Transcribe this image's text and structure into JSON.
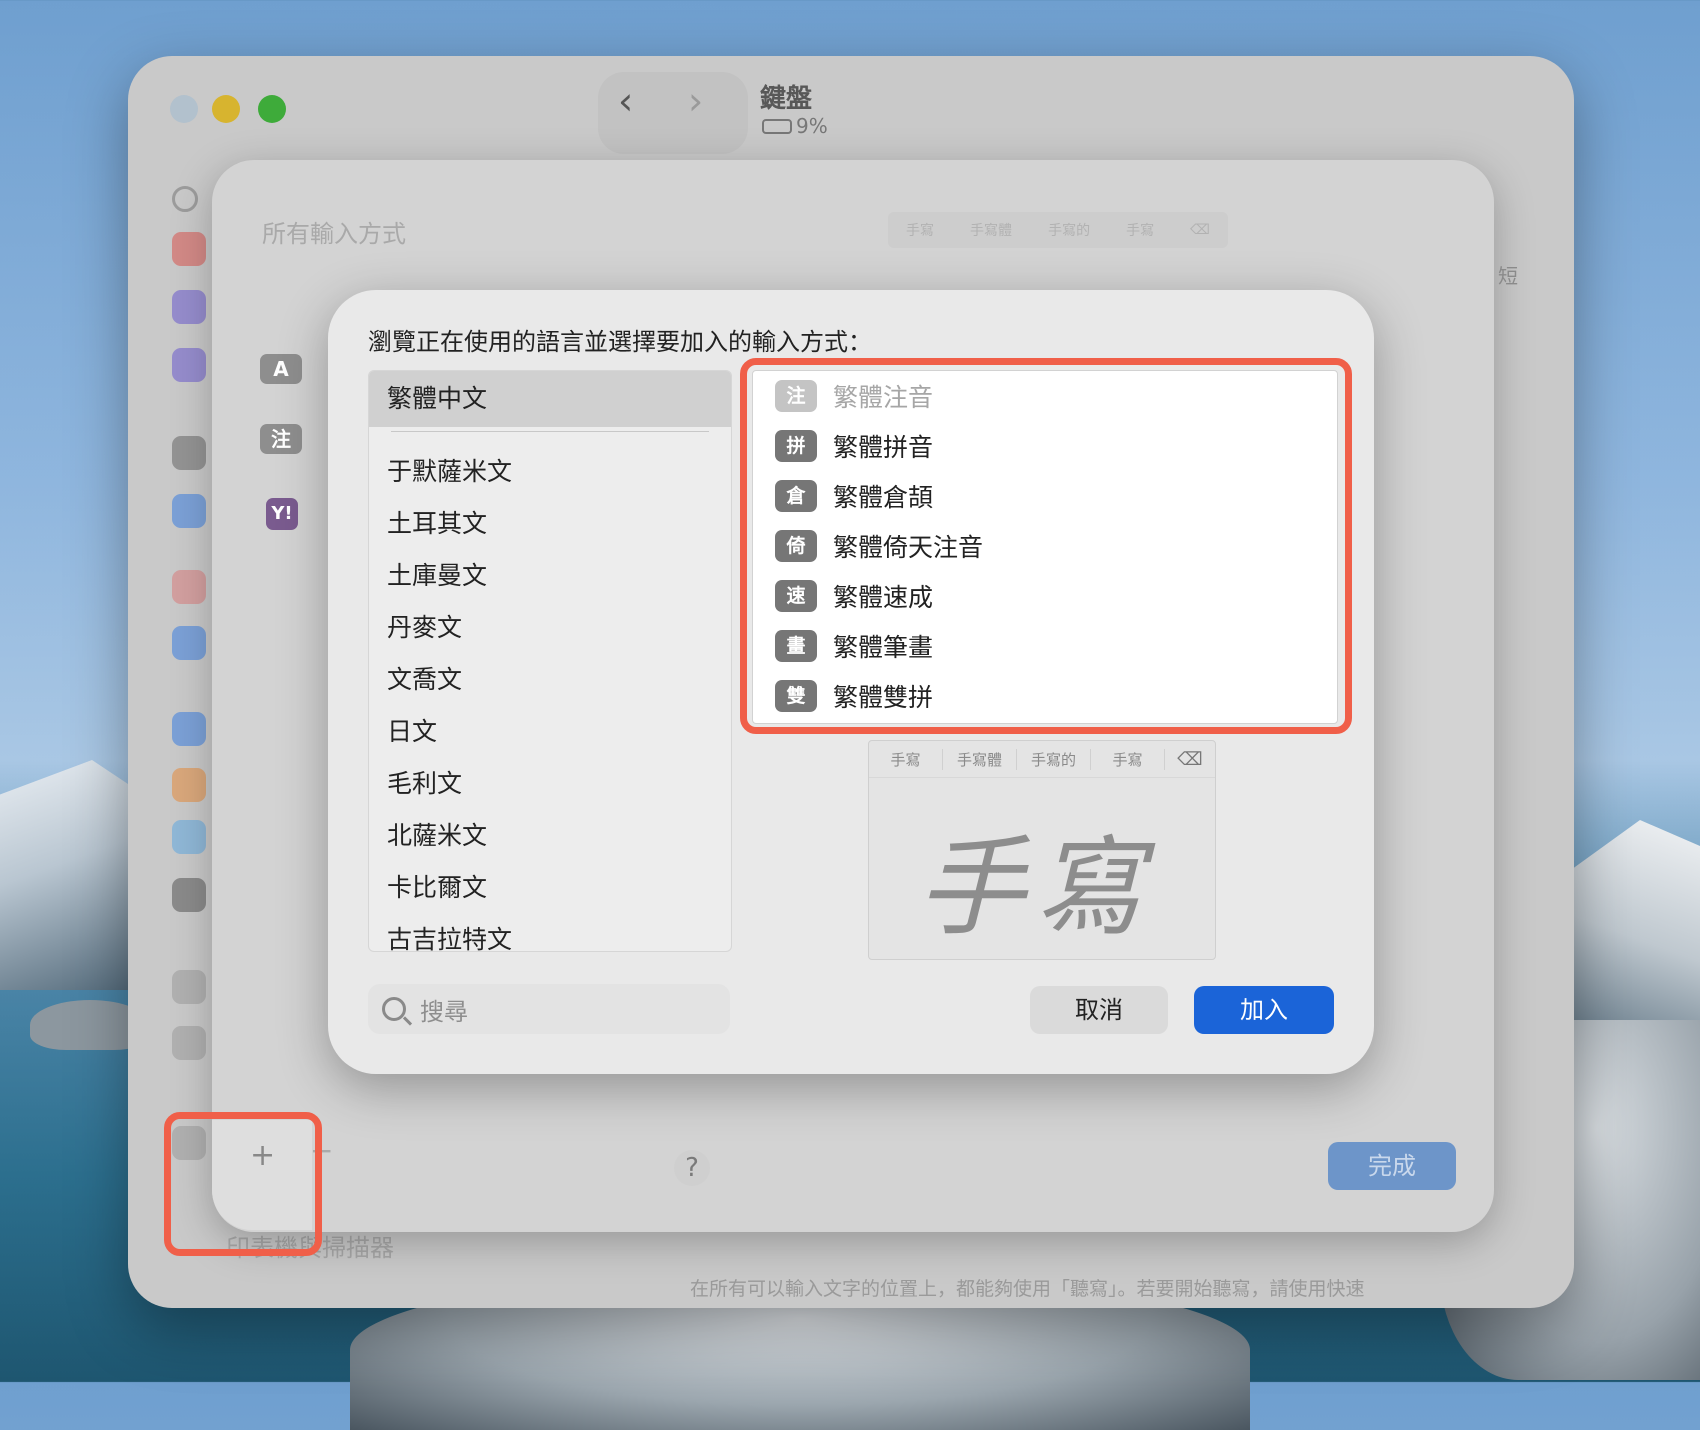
{
  "window": {
    "title": "鍵盤",
    "battery": "9%"
  },
  "sheet": {
    "title": "所有輸入方式",
    "row_icons": [
      "A",
      "注"
    ],
    "yahoo_icon": "Y!",
    "strip": [
      "手寫",
      "手寫體",
      "手寫的",
      "手寫"
    ],
    "help": "?",
    "done": "完成",
    "plus": "+",
    "minus": "−",
    "right_edge_text": "短"
  },
  "bottom": {
    "label": "印表機與掃描器",
    "dictation_text": "在所有可以輸入文字的位置上，都能夠使用「聽寫」。若要開始聽寫，請使用快速"
  },
  "dialog": {
    "prompt": "瀏覽正在使用的語言並選擇要加入的輸入方式：",
    "selected_language": "繁體中文",
    "languages": [
      "于默薩米文",
      "土耳其文",
      "土庫曼文",
      "丹麥文",
      "文喬文",
      "日文",
      "毛利文",
      "北薩米文",
      "卡比爾文",
      "古吉拉特文"
    ],
    "methods": [
      {
        "badge": "注",
        "label": "繁體注音",
        "dim": true
      },
      {
        "badge": "拼",
        "label": "繁體拼音"
      },
      {
        "badge": "倉",
        "label": "繁體倉頡"
      },
      {
        "badge": "倚",
        "label": "繁體倚天注音"
      },
      {
        "badge": "速",
        "label": "繁體速成"
      },
      {
        "badge": "畫",
        "label": "繁體筆畫"
      },
      {
        "badge": "雙",
        "label": "繁體雙拼"
      }
    ],
    "preview": {
      "strip": [
        "手寫",
        "手寫體",
        "手寫的",
        "手寫"
      ],
      "handwriting": "手寫"
    },
    "search_placeholder": "搜尋",
    "cancel": "取消",
    "add": "加入"
  },
  "colors": {
    "accent": "#1b64d8",
    "highlight": "#f05f49"
  }
}
